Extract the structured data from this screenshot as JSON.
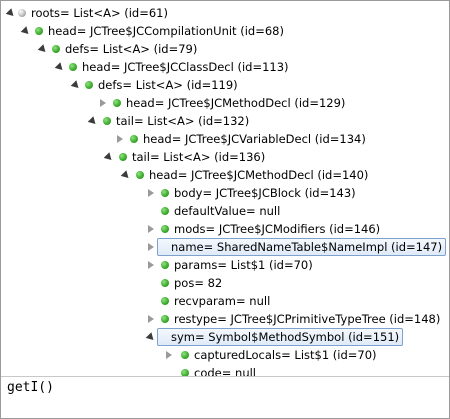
{
  "tree": {
    "rows": [
      {
        "label": "roots= List<A>  (id=61)"
      },
      {
        "label": "head= JCTree$JCCompilationUnit  (id=68)"
      },
      {
        "label": "defs= List<A>  (id=79)"
      },
      {
        "label": "head= JCTree$JCClassDecl  (id=113)"
      },
      {
        "label": "defs= List<A>  (id=119)"
      },
      {
        "label": "head= JCTree$JCMethodDecl  (id=129)"
      },
      {
        "label": "tail= List<A>  (id=132)"
      },
      {
        "label": "head= JCTree$JCVariableDecl  (id=134)"
      },
      {
        "label": "tail= List<A>  (id=136)"
      },
      {
        "label": "head= JCTree$JCMethodDecl  (id=140)"
      },
      {
        "label": "body= JCTree$JCBlock  (id=143)"
      },
      {
        "label": "defaultValue= null"
      },
      {
        "label": "mods= JCTree$JCModifiers  (id=146)"
      },
      {
        "label": "name= SharedNameTable$NameImpl  (id=147)"
      },
      {
        "label": "params= List$1  (id=70)"
      },
      {
        "label": "pos= 82"
      },
      {
        "label": "recvparam= null"
      },
      {
        "label": "restype= JCTree$JCPrimitiveTypeTree  (id=148)"
      },
      {
        "label": "sym= Symbol$MethodSymbol  (id=151)"
      },
      {
        "label": "capturedLocals= List$1  (id=70)"
      },
      {
        "label": "code= null"
      }
    ]
  },
  "detail": {
    "text": "getI()"
  }
}
